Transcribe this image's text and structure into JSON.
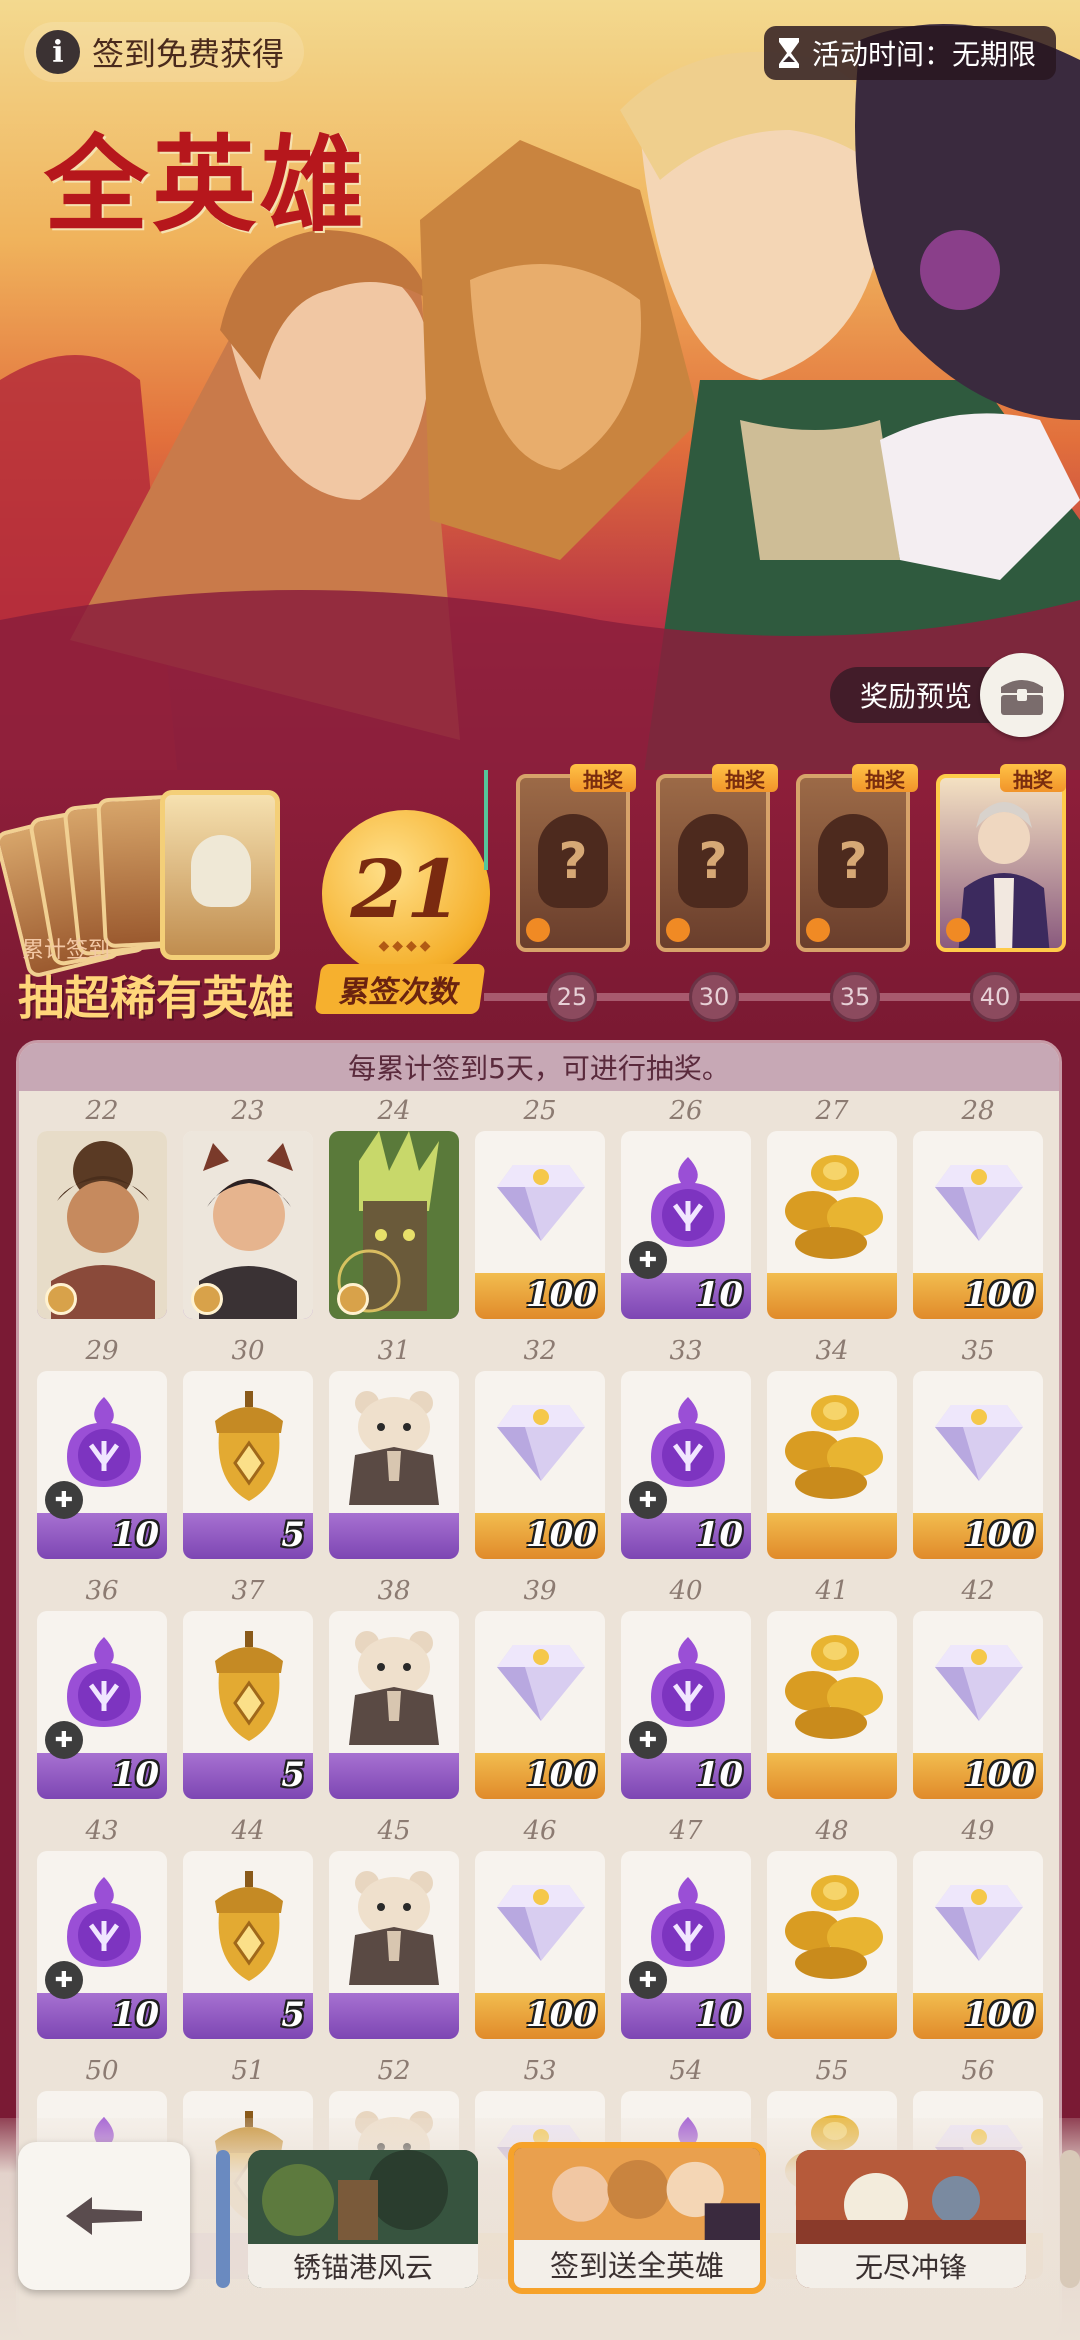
{
  "header": {
    "info_text": "签到免费获得",
    "activity_time": "活动时间：无期限",
    "title": "全英雄",
    "reward_preview": "奖励预览"
  },
  "lottery": {
    "caption_small": "累计签到",
    "caption_big": "抽超稀有英雄",
    "count": "21",
    "count_label": "累签次数",
    "prize_tag": "抽奖",
    "milestones": [
      "25",
      "30",
      "35",
      "40"
    ]
  },
  "checkin": {
    "notice": "每累计签到5天，可进行抽奖。",
    "rows": [
      [
        {
          "day": "22",
          "type": "hero-girl",
          "qty": ""
        },
        {
          "day": "23",
          "type": "hero-boy",
          "qty": ""
        },
        {
          "day": "24",
          "type": "hero-tree",
          "qty": ""
        },
        {
          "day": "25",
          "type": "gem",
          "qty": "100"
        },
        {
          "day": "26",
          "type": "orb",
          "qty": "10"
        },
        {
          "day": "27",
          "type": "coins",
          "qty": ""
        },
        {
          "day": "28",
          "type": "gem",
          "qty": "100"
        }
      ],
      [
        {
          "day": "29",
          "type": "orb",
          "qty": "10"
        },
        {
          "day": "30",
          "type": "acorn",
          "qty": "5"
        },
        {
          "day": "31",
          "type": "hamster",
          "qty": ""
        },
        {
          "day": "32",
          "type": "gem",
          "qty": "100"
        },
        {
          "day": "33",
          "type": "orb",
          "qty": "10"
        },
        {
          "day": "34",
          "type": "coins",
          "qty": ""
        },
        {
          "day": "35",
          "type": "gem",
          "qty": "100"
        }
      ],
      [
        {
          "day": "36",
          "type": "orb",
          "qty": "10"
        },
        {
          "day": "37",
          "type": "acorn",
          "qty": "5"
        },
        {
          "day": "38",
          "type": "hamster",
          "qty": ""
        },
        {
          "day": "39",
          "type": "gem",
          "qty": "100"
        },
        {
          "day": "40",
          "type": "orb",
          "qty": "10"
        },
        {
          "day": "41",
          "type": "coins",
          "qty": ""
        },
        {
          "day": "42",
          "type": "gem",
          "qty": "100"
        }
      ],
      [
        {
          "day": "43",
          "type": "orb",
          "qty": "10"
        },
        {
          "day": "44",
          "type": "acorn",
          "qty": "5"
        },
        {
          "day": "45",
          "type": "hamster",
          "qty": ""
        },
        {
          "day": "46",
          "type": "gem",
          "qty": "100"
        },
        {
          "day": "47",
          "type": "orb",
          "qty": "10"
        },
        {
          "day": "48",
          "type": "coins",
          "qty": ""
        },
        {
          "day": "49",
          "type": "gem",
          "qty": "100"
        }
      ],
      [
        {
          "day": "50",
          "type": "orb",
          "qty": ""
        },
        {
          "day": "51",
          "type": "acorn",
          "qty": ""
        },
        {
          "day": "52",
          "type": "hamster",
          "qty": ""
        },
        {
          "day": "53",
          "type": "gem",
          "qty": ""
        },
        {
          "day": "54",
          "type": "orb",
          "qty": ""
        },
        {
          "day": "55",
          "type": "coins",
          "qty": ""
        },
        {
          "day": "56",
          "type": "gem",
          "qty": ""
        }
      ]
    ]
  },
  "nav": {
    "tabs": [
      {
        "label": "锈锚港风云",
        "active": false
      },
      {
        "label": "签到送全英雄",
        "active": true
      },
      {
        "label": "无尽冲锋",
        "active": false
      }
    ]
  },
  "colors": {
    "accent": "#f6a22a",
    "title_red": "#b6171c",
    "band": "#8e1e3a",
    "panel": "#ece3d8"
  },
  "icons": [
    "info-icon",
    "hourglass-icon",
    "chest-icon",
    "back-arrow-icon",
    "puzzle-icon",
    "flame-icon"
  ]
}
